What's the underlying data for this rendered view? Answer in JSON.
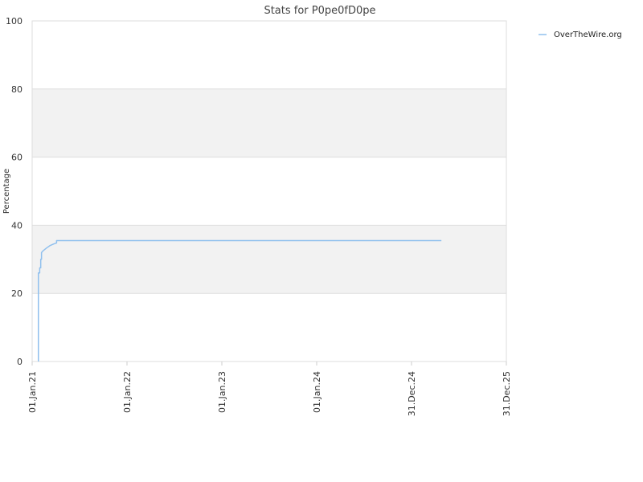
{
  "chart_data": {
    "type": "line",
    "title": "Stats for P0pe0fD0pe",
    "xlabel": "",
    "ylabel": "Percentage",
    "ylim": [
      0,
      100
    ],
    "yticks": [
      "0",
      "20",
      "40",
      "60",
      "80",
      "100"
    ],
    "xlim": [
      "2021-01-01",
      "2025-12-31"
    ],
    "xticks": [
      {
        "date": "2021-01-01",
        "label": "01.Jan.21"
      },
      {
        "date": "2022-01-01",
        "label": "01.Jan.22"
      },
      {
        "date": "2023-01-01",
        "label": "01.Jan.23"
      },
      {
        "date": "2024-01-01",
        "label": "01.Jan.24"
      },
      {
        "date": "2024-12-31",
        "label": "31.Dec.24"
      },
      {
        "date": "2025-12-31",
        "label": "31.Dec.25"
      }
    ],
    "grid": true,
    "alternating_bands": true,
    "legend_position": "top-right",
    "series": [
      {
        "name": "OverTheWire.org",
        "color": "#90c0ee",
        "points": [
          {
            "x": "2021-01-25",
            "y": 0
          },
          {
            "x": "2021-01-25",
            "y": 26
          },
          {
            "x": "2021-01-30",
            "y": 26
          },
          {
            "x": "2021-01-30",
            "y": 27.5
          },
          {
            "x": "2021-02-03",
            "y": 27.5
          },
          {
            "x": "2021-02-03",
            "y": 30
          },
          {
            "x": "2021-02-06",
            "y": 30
          },
          {
            "x": "2021-02-06",
            "y": 32
          },
          {
            "x": "2021-02-12",
            "y": 32.5
          },
          {
            "x": "2021-02-25",
            "y": 33.3
          },
          {
            "x": "2021-03-10",
            "y": 34
          },
          {
            "x": "2021-03-25",
            "y": 34.5
          },
          {
            "x": "2021-04-05",
            "y": 34.8
          },
          {
            "x": "2021-04-05",
            "y": 35.5
          },
          {
            "x": "2025-04-25",
            "y": 35.5
          }
        ]
      }
    ]
  }
}
